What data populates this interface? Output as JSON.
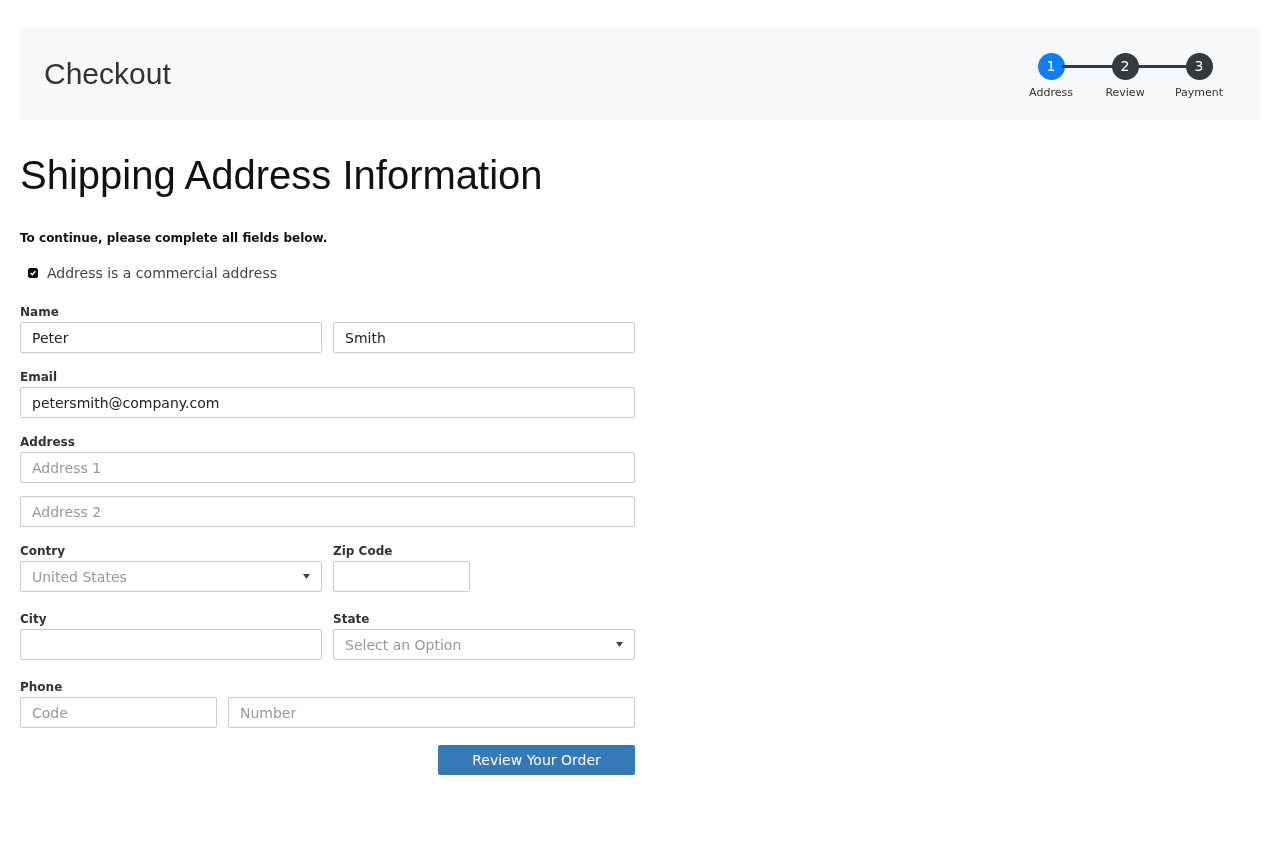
{
  "header": {
    "title": "Checkout"
  },
  "steps": [
    {
      "number": "1",
      "label": "Address",
      "selected": true
    },
    {
      "number": "2",
      "label": "Review",
      "selected": false
    },
    {
      "number": "3",
      "label": "Payment",
      "selected": false
    }
  ],
  "heading": "Shipping Address Information",
  "instruction": "To continue, please complete all fields below.",
  "commercial": {
    "label": "Address is a commercial address",
    "checked": true
  },
  "name": {
    "label": "Name",
    "first": {
      "value": "Peter"
    },
    "last": {
      "value": "Smith"
    }
  },
  "email": {
    "label": "Email",
    "value": "petersmith@company.com"
  },
  "address": {
    "label": "Address",
    "line1": {
      "placeholder": "Address 1"
    },
    "line2": {
      "placeholder": "Address 2"
    }
  },
  "country": {
    "label": "Contry",
    "placeholder": "United States"
  },
  "zip": {
    "label": "Zip Code"
  },
  "city": {
    "label": "City"
  },
  "state": {
    "label": "State",
    "placeholder": "Select an Option"
  },
  "phone": {
    "label": "Phone",
    "code": {
      "placeholder": "Code"
    },
    "number": {
      "placeholder": "Number"
    }
  },
  "submit": {
    "label": "Review Your Order"
  }
}
